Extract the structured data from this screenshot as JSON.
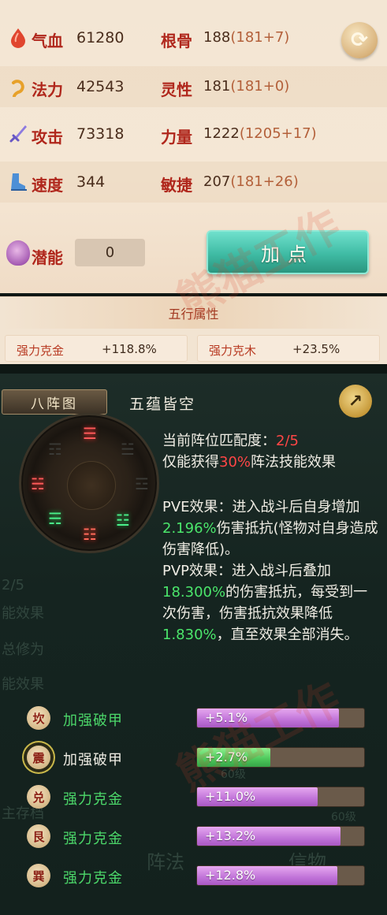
{
  "attributes": [
    {
      "icon": "blood-drop-icon",
      "label": "气血",
      "value": "61280",
      "label2": "根骨",
      "value2": "188",
      "bonus2": "(181+7)"
    },
    {
      "icon": "mana-swirl-icon",
      "label": "法力",
      "value": "42543",
      "label2": "灵性",
      "value2": "181",
      "bonus2": "(181+0)"
    },
    {
      "icon": "sword-icon",
      "label": "攻击",
      "value": "73318",
      "label2": "力量",
      "value2": "1222",
      "bonus2": "(1205+17)"
    },
    {
      "icon": "boot-icon",
      "label": "速度",
      "value": "344",
      "label2": "敏捷",
      "value2": "207",
      "bonus2": "(181+26)"
    }
  ],
  "potential": {
    "label": "潜能",
    "value": "0"
  },
  "add_point_button": "加点",
  "wuxing": {
    "title": "五行属性",
    "items": [
      {
        "name": "强力克金",
        "value": "+118.8%"
      },
      {
        "name": "强力克木",
        "value": "+23.5%"
      }
    ]
  },
  "formation": {
    "tab": "八阵图",
    "name": "五蕴皆空",
    "match_label": "当前阵位匹配度：",
    "match_value": "2/5",
    "effect_prefix": "仅能获得",
    "effect_percent": "30%",
    "effect_suffix": "阵法技能效果",
    "pve_prefix": "PVE效果：进入战斗后自身增加",
    "pve_value": "2.196%",
    "pve_suffix": "伤害抵抗(怪物对自身造成伤害降低)。",
    "pvp_prefix": "PVP效果：进入战斗后叠加",
    "pvp_value": "18.300%",
    "pvp_middle": "的伤害抵抗，每受到一次伤害，伤害抵抗效果降低",
    "pvp_value2": "1.830%",
    "pvp_suffix": "，直至效果全部消失。"
  },
  "skills": [
    {
      "glyph": "坎",
      "name": "加强破甲",
      "value": "+5.1%",
      "fill": 0.85,
      "color": "purple",
      "active": false,
      "name_grey": false
    },
    {
      "glyph": "震",
      "name": "加强破甲",
      "value": "+2.7%",
      "fill": 0.44,
      "color": "green",
      "active": true,
      "name_grey": true
    },
    {
      "glyph": "兑",
      "name": "强力克金",
      "value": "+11.0%",
      "fill": 0.72,
      "color": "purple",
      "active": false,
      "name_grey": false
    },
    {
      "glyph": "艮",
      "name": "强力克金",
      "value": "+13.2%",
      "fill": 0.86,
      "color": "purple",
      "active": false,
      "name_grey": false
    },
    {
      "glyph": "巽",
      "name": "强力克金",
      "value": "+12.8%",
      "fill": 0.84,
      "color": "purple",
      "active": false,
      "name_grey": false
    }
  ],
  "background_ghost_text": [
    "2/5",
    "能效果",
    "总修为",
    "能效果",
    "60级",
    "60级",
    "主存档",
    "阵法",
    "信物"
  ],
  "watermark": "熊猫工作"
}
